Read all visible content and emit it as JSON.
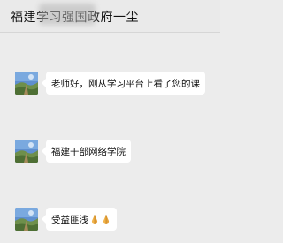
{
  "header": {
    "title": "福建学习强国政府一尘"
  },
  "messages": [
    {
      "text": "老师好，刚从学习平台上看了您的课",
      "avatar": "avatar-landscape-icon"
    },
    {
      "text": "福建干部网络学院",
      "avatar": "avatar-landscape-icon"
    },
    {
      "text": "受益匪浅",
      "emoji": [
        "praying-hands-icon",
        "praying-hands-icon"
      ],
      "avatar": "avatar-landscape-icon"
    }
  ]
}
